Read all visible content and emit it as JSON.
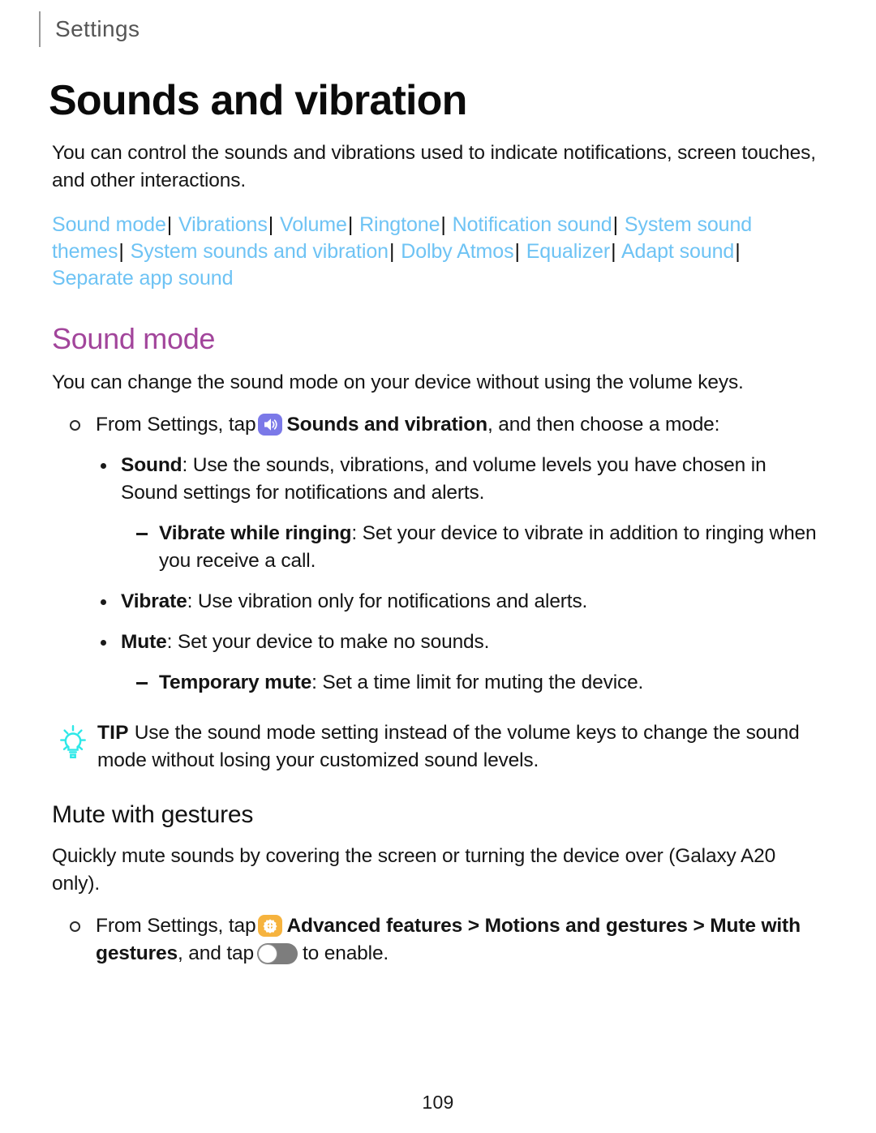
{
  "header": {
    "breadcrumb": "Settings"
  },
  "page_title": "Sounds and vibration",
  "intro": "You can control the sounds and vibrations used to indicate notifications, screen touches, and other interactions.",
  "links": [
    {
      "label": "Sound mode"
    },
    {
      "label": "Vibrations"
    },
    {
      "label": "Volume"
    },
    {
      "label": "Ringtone"
    },
    {
      "label": "Notification sound"
    },
    {
      "label": "System sound themes"
    },
    {
      "label": "System sounds and vibration"
    },
    {
      "label": "Dolby Atmos"
    },
    {
      "label": "Equalizer"
    },
    {
      "label": "Adapt sound"
    },
    {
      "label": "Separate app sound"
    }
  ],
  "link_separator": "|",
  "sound_mode": {
    "heading": "Sound mode",
    "intro": "You can change the sound mode on your device without using the volume keys.",
    "step": {
      "prefix": "From Settings, tap",
      "icon": "speaker-icon",
      "bold_target": "Sounds and vibration",
      "suffix": ", and then choose a mode:"
    },
    "items": [
      {
        "term": "Sound",
        "text": ": Use the sounds, vibrations, and volume levels you have chosen in Sound settings for notifications and alerts.",
        "sub": {
          "term": "Vibrate while ringing",
          "text": ": Set your device to vibrate in addition to ringing when you receive a call."
        }
      },
      {
        "term": "Vibrate",
        "text": ": Use vibration only for notifications and alerts."
      },
      {
        "term": "Mute",
        "text": ": Set your device to make no sounds.",
        "sub": {
          "term": "Temporary mute",
          "text": ": Set a time limit for muting the device."
        }
      }
    ],
    "tip": {
      "icon": "lightbulb-icon",
      "label": "TIP",
      "text": "Use the sound mode setting instead of the volume keys to change the sound mode without losing your customized sound levels."
    }
  },
  "mute_with_gestures": {
    "heading": "Mute with gestures",
    "intro": "Quickly mute sounds by covering the screen or turning the device over (Galaxy A20 only).",
    "step": {
      "prefix": "From Settings, tap",
      "icon": "gear-icon",
      "bold_path": "Advanced features > Motions and gestures > Mute with gestures",
      "mid": ", and tap",
      "toggle": "toggle-switch-off",
      "suffix": "to enable."
    }
  },
  "footer": {
    "page_number": "109"
  },
  "colors": {
    "link": "#6ec3f4",
    "section_heading": "#a2459b",
    "speaker_icon_bg": "#7b79e8",
    "gear_icon_bg": "#f6b33e",
    "tip_icon": "#2ee8e8",
    "toggle_track": "#7d7d7d"
  }
}
